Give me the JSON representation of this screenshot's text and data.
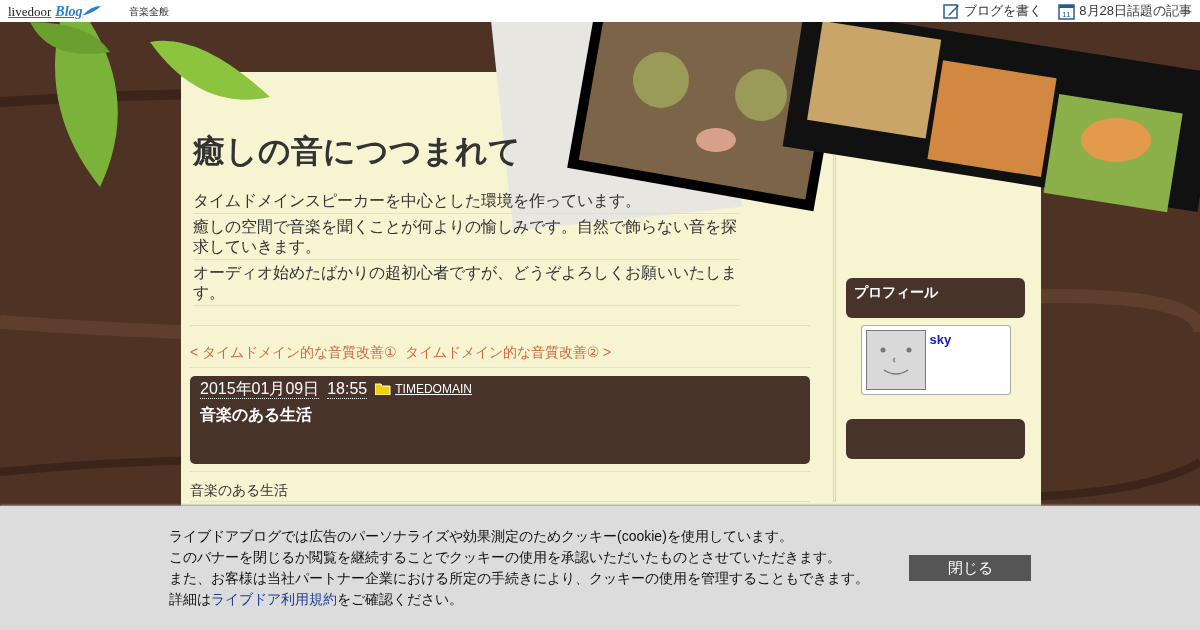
{
  "topbar": {
    "logo": "livedoor",
    "logo_script": "Blog",
    "category": "音楽全般",
    "actions": [
      {
        "kind": "write",
        "label": "ブログを書く"
      },
      {
        "kind": "calendar",
        "label": "8月28日話題の記事",
        "icon_text": "11"
      }
    ]
  },
  "blog": {
    "title": "癒しの音につつまれて",
    "description": [
      "タイムドメインスピーカーを中心とした環境を作っています。",
      "癒しの空間で音楽を聞くことが何よりの愉しみです。自然で飾らない音を探求していきます。",
      "オーディオ始めたばかりの超初心者ですが、どうぞよろしくお願いいたします。"
    ]
  },
  "post_nav": {
    "prev": "< タイムドメイン的な音質改善①",
    "next": "タイムドメイン的な音質改善② >"
  },
  "post": {
    "date": "2015年01月09日",
    "time": "18:55",
    "category": "TIMEDOMAIN",
    "title": "音楽のある生活",
    "body": "音楽のある生活"
  },
  "sidebar": {
    "profile_heading": "プロフィール",
    "profile_name": "sky"
  },
  "cookie_banner": {
    "lines": [
      "ライブドアブログでは広告のパーソナライズや効果測定のためクッキー(cookie)を使用しています。",
      "このバナーを閉じるか閲覧を継続することでクッキーの使用を承認いただいたものとさせていただきます。",
      "また、お客様は当社パートナー企業における所定の手続きにより、クッキーの使用を管理することもできます。"
    ],
    "last_prefix": "詳細は",
    "last_link": "ライブドア利用規約",
    "last_suffix": "をご確認ください。",
    "close": "閉じる"
  }
}
